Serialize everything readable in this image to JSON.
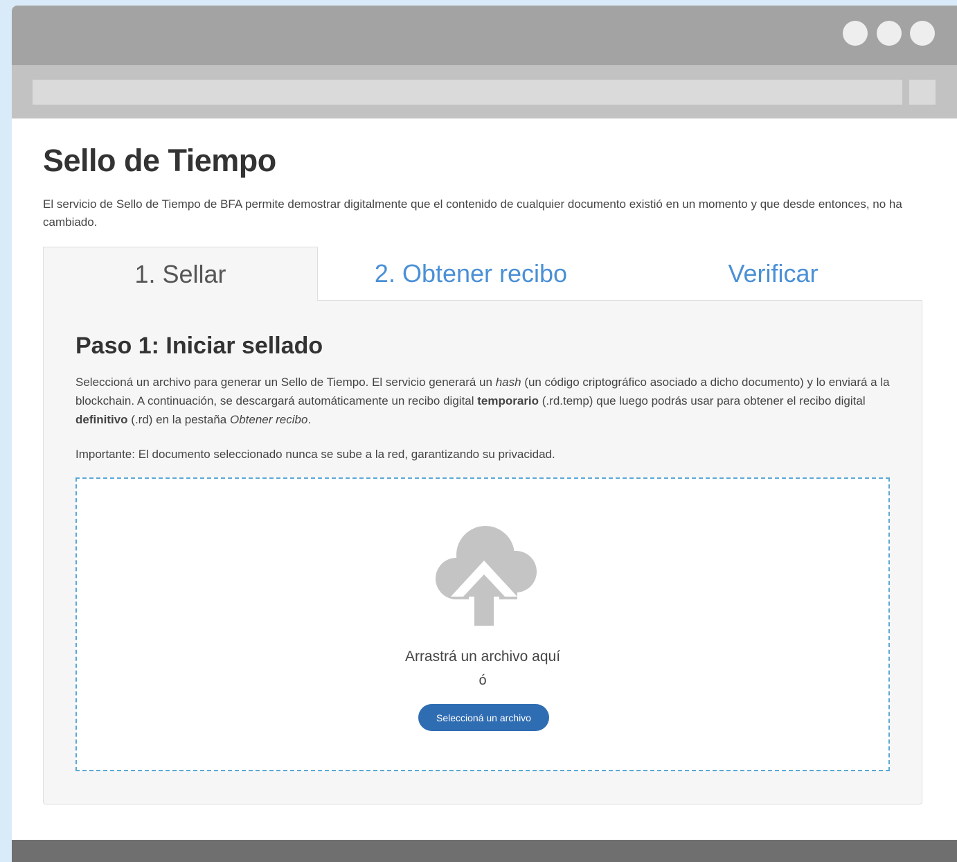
{
  "page": {
    "title": "Sello de Tiempo",
    "intro": "El servicio de Sello de Tiempo de BFA permite demostrar digitalmente que el contenido de cualquier documento existió en un momento y que desde entonces, no ha cambiado."
  },
  "tabs": [
    {
      "label": "1. Sellar",
      "active": true
    },
    {
      "label": "2. Obtener recibo",
      "active": false
    },
    {
      "label": "Verificar",
      "active": false
    }
  ],
  "step": {
    "title": "Paso 1: Iniciar sellado",
    "p1": "Seleccioná un archivo para generar un Sello de Tiempo. El servicio generará un ",
    "hash_word": "hash",
    "p2": " (un código criptográfico asociado a dicho documento) y lo enviará a la blockchain. A continuación, se descargará automáticamente un recibo digital ",
    "temp_word": "temporario",
    "p3": " (.rd.temp) que luego podrás usar para obtener el recibo digital ",
    "def_word": "definitivo",
    "p4": " (.rd) en la pestaña ",
    "tab_ref": "Obtener recibo",
    "p5": ".",
    "important": "Importante: El documento seleccionado nunca se sube a la red, garantizando su privacidad."
  },
  "dropzone": {
    "icon": "cloud-upload-icon",
    "text": "Arrastrá un archivo aquí",
    "or": "ó",
    "button": "Seleccioná un archivo"
  },
  "colors": {
    "accent": "#4a90d6",
    "button": "#2f6db3",
    "dropzone_border": "#5aa8d6"
  }
}
